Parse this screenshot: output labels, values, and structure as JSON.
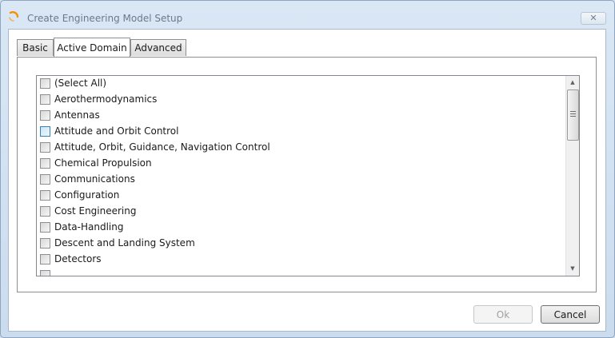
{
  "window": {
    "title": "Create Engineering Model Setup",
    "close_glyph": "✕",
    "accent_color": "#f39200"
  },
  "tabs": [
    {
      "label": "Basic",
      "selected": false
    },
    {
      "label": "Active Domain",
      "selected": true
    },
    {
      "label": "Advanced",
      "selected": false
    }
  ],
  "domain_list": {
    "items": [
      {
        "label": "(Select All)",
        "checked": false
      },
      {
        "label": "Aerothermodynamics",
        "checked": false
      },
      {
        "label": "Antennas",
        "checked": false
      },
      {
        "label": "Attitude and Orbit Control",
        "checked": false,
        "hovered": true
      },
      {
        "label": "Attitude, Orbit, Guidance, Navigation Control",
        "checked": false
      },
      {
        "label": "Chemical Propulsion",
        "checked": false
      },
      {
        "label": "Communications",
        "checked": false
      },
      {
        "label": "Configuration",
        "checked": false
      },
      {
        "label": "Cost Engineering",
        "checked": false
      },
      {
        "label": "Data-Handling",
        "checked": false
      },
      {
        "label": "Descent and Landing System",
        "checked": false
      },
      {
        "label": "Detectors",
        "checked": false
      },
      {
        "label": "",
        "checked": false
      }
    ],
    "scroll_up_glyph": "▲",
    "scroll_down_glyph": "▼"
  },
  "buttons": {
    "ok_label": "Ok",
    "ok_enabled": false,
    "cancel_label": "Cancel"
  }
}
